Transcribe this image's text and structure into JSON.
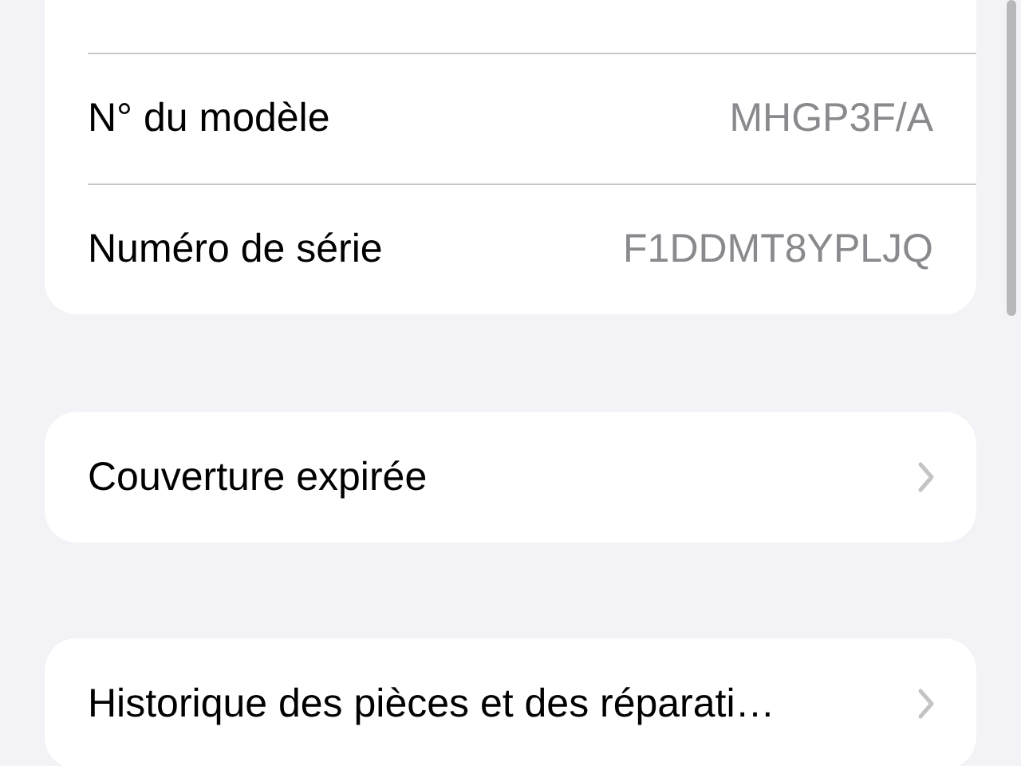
{
  "device_info": [
    {
      "label": "N° du modèle",
      "value": "MHGP3F/A"
    },
    {
      "label": "Numéro de série",
      "value": "F1DDMT8YPLJQ"
    }
  ],
  "links": [
    {
      "label": "Couverture expirée"
    },
    {
      "label": "Historique des pièces et des réparati…"
    }
  ]
}
